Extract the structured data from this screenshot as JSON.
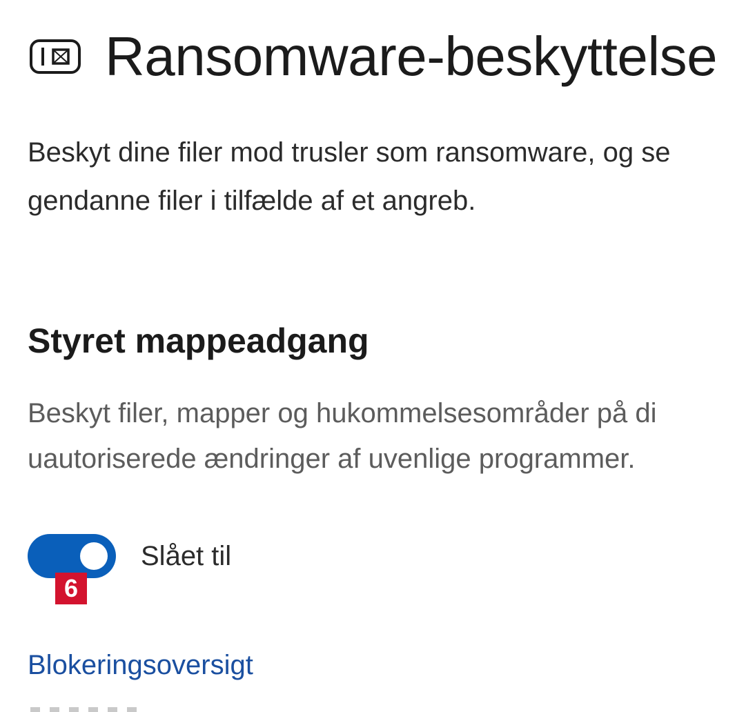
{
  "header": {
    "icon": "ransomware-protection-icon",
    "title": "Ransomware-beskyttelse"
  },
  "intro": {
    "line1": "Beskyt dine filer mod trusler som ransomware, og se",
    "line2": "gendanne filer i tilfælde af et angreb."
  },
  "section": {
    "title": "Styret mappeadgang",
    "desc_line1": "Beskyt filer, mapper og hukommelsesområder på di",
    "desc_line2": "uautoriserede ændringer af uvenlige programmer."
  },
  "toggle": {
    "state": "on",
    "label": "Slået til",
    "color": "#0a5fba"
  },
  "annotation": {
    "badge": "6",
    "color": "#d3132e"
  },
  "links": {
    "block_history": "Blokeringsoversigt"
  }
}
